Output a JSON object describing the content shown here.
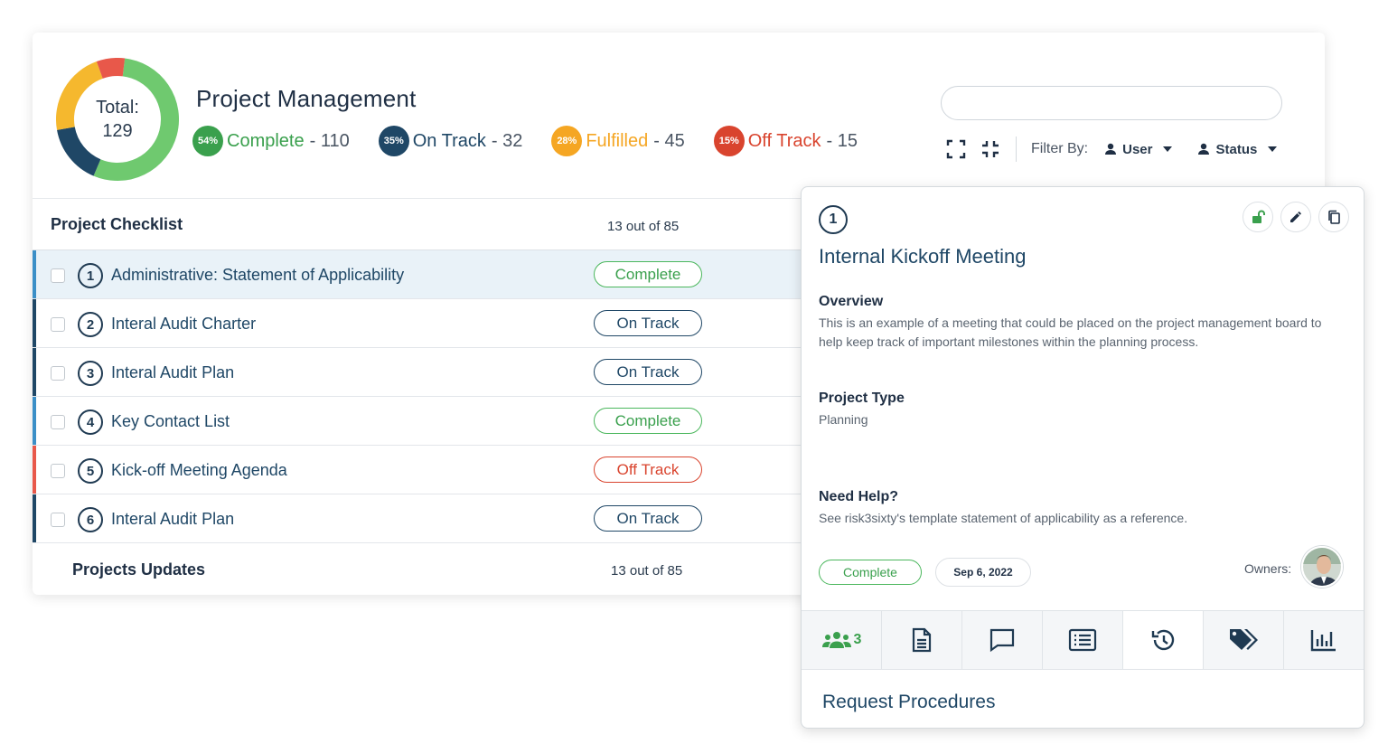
{
  "header": {
    "title": "Project Management",
    "total_label": "Total:",
    "total_value": "129",
    "stats": [
      {
        "pct": "54%",
        "label": "Complete",
        "count": "- 110",
        "color": "#3aa04d"
      },
      {
        "pct": "35%",
        "label": "On Track",
        "count": "- 32",
        "color": "#1f4766"
      },
      {
        "pct": "28%",
        "label": "Fulfilled",
        "count": "- 45",
        "color": "#f5a623"
      },
      {
        "pct": "15%",
        "label": "Off Track",
        "count": "- 15",
        "color": "#d9442e"
      }
    ],
    "search": {
      "value": "",
      "placeholder": ""
    },
    "filter_label": "Filter By:",
    "filters": [
      "User",
      "Status"
    ]
  },
  "checklist": {
    "title": "Project Checklist",
    "count": "13 out of 85",
    "rows": [
      {
        "num": "1",
        "name": "Administrative: Statement of Applicability",
        "status": "Complete",
        "status_color": "#3aa04d",
        "accent": "#3b8fc7"
      },
      {
        "num": "2",
        "name": "Interal Audit Charter",
        "status": "On Track",
        "status_color": "#1f4766",
        "accent": "#1f4766"
      },
      {
        "num": "3",
        "name": "Interal Audit Plan",
        "status": "On Track",
        "status_color": "#1f4766",
        "accent": "#1f4766"
      },
      {
        "num": "4",
        "name": "Key Contact List",
        "status": "Complete",
        "status_color": "#3aa04d",
        "accent": "#3b8fc7"
      },
      {
        "num": "5",
        "name": "Kick-off Meeting Agenda",
        "status": "Off Track",
        "status_color": "#d9442e",
        "accent": "#e8584a"
      },
      {
        "num": "6",
        "name": "Interal Audit Plan",
        "status": "On Track",
        "status_color": "#1f4766",
        "accent": "#1f4766"
      }
    ]
  },
  "updates": {
    "title": "Projects Updates",
    "count": "13 out of 85"
  },
  "detail": {
    "num": "1",
    "title": "Internal Kickoff Meeting",
    "overview_heading": "Overview",
    "overview_text": "This is an example of a meeting that could be placed on the project management board to help keep track of important milestones within the planning process.",
    "type_heading": "Project Type",
    "type_text": "Planning",
    "help_heading": "Need Help?",
    "help_text": "See risk3sixty's template statement of applicability as a reference.",
    "status": "Complete",
    "date": "Sep 6, 2022",
    "owners_label": "Owners:",
    "team_count": "3",
    "footer": "Request Procedures"
  },
  "icons": {
    "actions": [
      "unlock-icon",
      "pencil-icon",
      "copy-icon"
    ],
    "tabs": [
      "team-icon",
      "document-icon",
      "comment-icon",
      "list-icon",
      "history-icon",
      "tags-icon",
      "chart-icon"
    ]
  },
  "colors": {
    "complete": "#3aa04d",
    "on_track": "#1f4766",
    "fulfilled": "#f5a623",
    "off_track": "#d9442e"
  }
}
